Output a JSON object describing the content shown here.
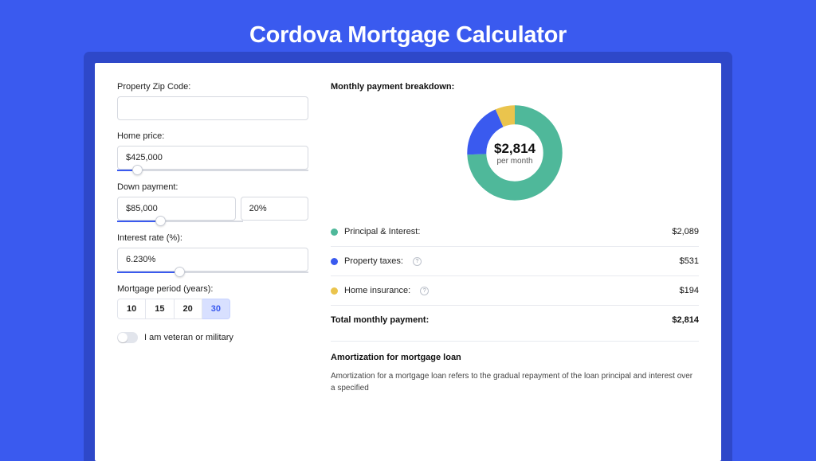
{
  "header": {
    "title": "Cordova Mortgage Calculator"
  },
  "form": {
    "zip": {
      "label": "Property Zip Code:",
      "value": ""
    },
    "home_price": {
      "label": "Home price:",
      "value": "$425,000",
      "slider_pct": 8
    },
    "down_payment": {
      "label": "Down payment:",
      "amount": "$85,000",
      "percent": "20%",
      "slider_pct": 20
    },
    "interest": {
      "label": "Interest rate (%):",
      "value": "6.230%",
      "slider_pct": 30
    },
    "period": {
      "label": "Mortgage period (years):",
      "options": [
        "10",
        "15",
        "20",
        "30"
      ],
      "selected": "30"
    },
    "veteran": {
      "label": "I am veteran or military",
      "on": false
    }
  },
  "breakdown": {
    "title": "Monthly payment breakdown:",
    "center_amount": "$2,814",
    "center_sub": "per month",
    "rows": [
      {
        "label": "Principal & Interest:",
        "value": "$2,089",
        "color": "green",
        "info": false
      },
      {
        "label": "Property taxes:",
        "value": "$531",
        "color": "blue",
        "info": true
      },
      {
        "label": "Home insurance:",
        "value": "$194",
        "color": "yellow",
        "info": true
      }
    ],
    "total_label": "Total monthly payment:",
    "total_value": "$2,814"
  },
  "amort": {
    "title": "Amortization for mortgage loan",
    "text": "Amortization for a mortgage loan refers to the gradual repayment of the loan principal and interest over a specified"
  },
  "chart_data": {
    "type": "pie",
    "title": "Monthly payment breakdown",
    "series": [
      {
        "name": "Principal & Interest",
        "value": 2089,
        "color": "#4fb89a"
      },
      {
        "name": "Property taxes",
        "value": 531,
        "color": "#3a5aef"
      },
      {
        "name": "Home insurance",
        "value": 194,
        "color": "#eac44d"
      }
    ],
    "total": 2814,
    "center_label": "$2,814 per month"
  }
}
